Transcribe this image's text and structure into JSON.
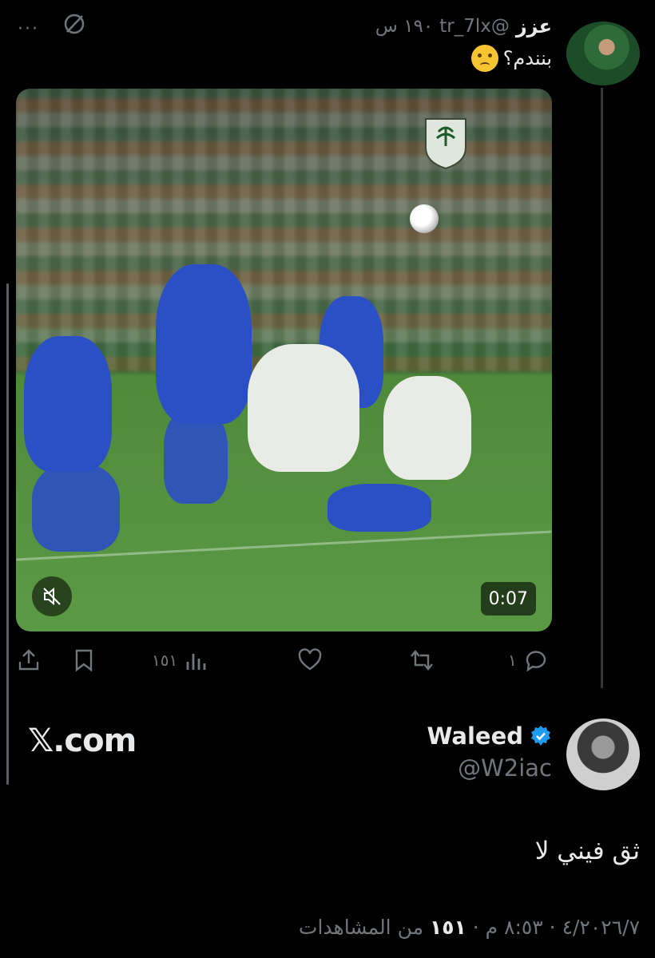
{
  "tweet": {
    "author_name": "عزز",
    "handle": "@tr_7lx",
    "time": "١٩٠ س",
    "text": "بنندم؟",
    "emoji": "crying-face",
    "menu": "···",
    "video": {
      "duration": "0:07"
    },
    "actions": {
      "replies": "١",
      "views": "١٥١"
    }
  },
  "quote": {
    "site": "𝕏.com",
    "name": "Waleed",
    "handle": "@W2iac",
    "text": "ثق فيني لا",
    "meta_date": "٤/٢٠٢٦/٧ · ٨:٥٣ م ·",
    "meta_views": "١٥١",
    "meta_suffix": "من المشاهدات"
  },
  "colors": {
    "background": "#000000",
    "muted": "#71767b",
    "verified": "#1d9bf0"
  }
}
